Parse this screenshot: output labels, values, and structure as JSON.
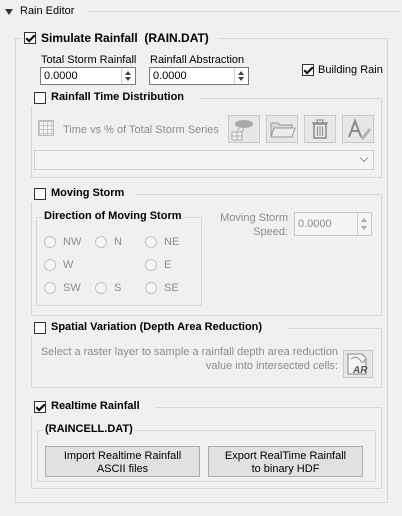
{
  "editor": {
    "title": "Rain Editor"
  },
  "simulate": {
    "label": "Simulate Rainfall  (RAIN.DAT)",
    "total_label": "Total Storm Rainfall",
    "total_value": "0.0000",
    "abstraction_label": "Rainfall Abstraction",
    "abstraction_value": "0.0000",
    "building_label": "Building Rain"
  },
  "distribution": {
    "label": "Rainfall Time Distribution",
    "series_label": "Time vs % of Total Storm Series"
  },
  "moving": {
    "label": "Moving Storm",
    "direction_label": "Direction of Moving Storm",
    "directions": [
      "NW",
      "N",
      "NE",
      "W",
      "E",
      "SW",
      "S",
      "SE"
    ],
    "speed_label_1": "Moving Storm",
    "speed_label_2": "Speed:",
    "speed_value": "0.0000"
  },
  "spatial": {
    "label": "Spatial Variation (Depth Area Reduction)",
    "desc_1": "Select a raster layer to sample a rainfall depth area reduction",
    "desc_2": "value into intersected cells:",
    "ar_icon_text": "AR"
  },
  "realtime": {
    "label": "Realtime Rainfall",
    "file_label": "(RAINCELL.DAT)",
    "import_1": "Import Realtime Rainfall",
    "import_2": "ASCII files",
    "export_1": "Export RealTime Rainfall",
    "export_2": "to binary HDF"
  }
}
